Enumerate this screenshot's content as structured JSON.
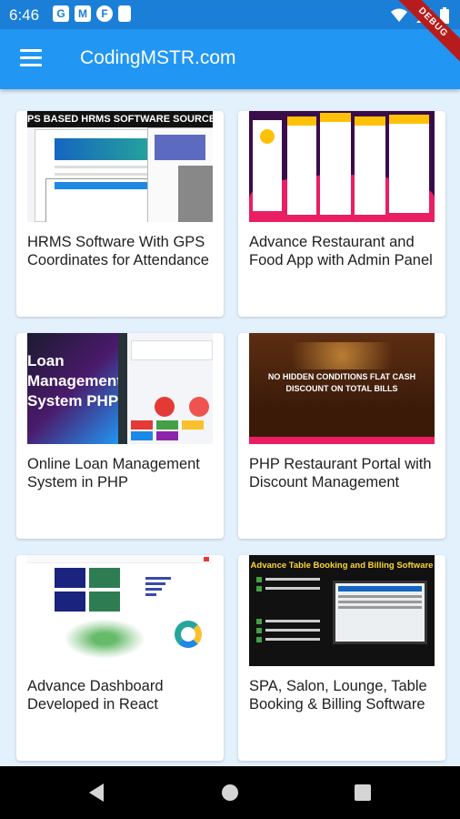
{
  "status_bar": {
    "time": "6:46"
  },
  "app_bar": {
    "title": "CodingMSTR.com",
    "debug_label": "DEBUG"
  },
  "cards": [
    {
      "title": "HRMS Software With GPS Coordinates for Attendance",
      "thumb_caption": "PS BASED HRMS SOFTWARE SOURCE COD"
    },
    {
      "title": "Advance Restaurant and Food App with Admin Panel"
    },
    {
      "title": "Online Loan Management System in PHP",
      "thumb_caption": "Loan Management System PHP"
    },
    {
      "title": "PHP Restaurant Portal with Discount Management",
      "thumb_caption": "NO HIDDEN CONDITIONS FLAT CASH DISCOUNT ON TOTAL BILLS"
    },
    {
      "title": "Advance Dashboard Developed in React"
    },
    {
      "title": "SPA, Salon, Lounge, Table Booking & Billing Software",
      "thumb_caption": "Advance Table Booking and Billing Software"
    }
  ],
  "colors": {
    "app_bar": "#2196f3",
    "status_bar": "#1b7fd8",
    "background": "#e3f1fd"
  }
}
